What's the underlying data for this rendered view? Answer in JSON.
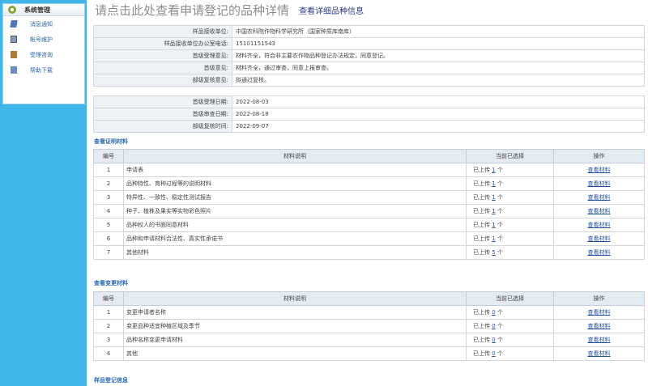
{
  "sidebar": {
    "title": "系统管理",
    "items": [
      {
        "label": "消息通知",
        "icon": "message-icon"
      },
      {
        "label": "帐号维护",
        "icon": "account-icon"
      },
      {
        "label": "受理咨询",
        "icon": "consult-icon"
      },
      {
        "label": "帮助下载",
        "icon": "download-icon"
      }
    ]
  },
  "header": {
    "title": "请点击此处查看申请登记的品种详情",
    "detail_link": "查看详细品种信息"
  },
  "info": [
    {
      "label": "样品接收单位:",
      "value": "中国农科院作物科学研究所（国家种质库南库）"
    },
    {
      "label": "样品接收单位办公室电话:",
      "value": "15101151543"
    },
    {
      "label": "首级受理意见:",
      "value": "材料齐全，符合非主要农作物品种登记办法规定，同意登记。"
    },
    {
      "label": "首级意见:",
      "value": "材料齐全，通过审查，同意上报审查。"
    },
    {
      "label": "部级复核意见:",
      "value": "拟通过复核。"
    }
  ],
  "dates": [
    {
      "label": "首级受理日期:",
      "value": "2022-08-03"
    },
    {
      "label": "首级审查日期:",
      "value": "2022-08-18"
    },
    {
      "label": "部级复核时间:",
      "value": "2022-09-07"
    }
  ],
  "proof": {
    "section_title": "查看证明材料",
    "headers": {
      "no": "编号",
      "desc": "材料说明",
      "sel": "当前已选择",
      "op": "操作"
    },
    "rows": [
      {
        "no": "1",
        "desc": "申请表",
        "sel_pre": "已上传",
        "count": "1",
        "unit": "个",
        "op": "查看材料"
      },
      {
        "no": "2",
        "desc": "品种特性、育种过程等的说明材料",
        "sel_pre": "已上传",
        "count": "1",
        "unit": "个",
        "op": "查看材料"
      },
      {
        "no": "3",
        "desc": "特异性、一致性、稳定性测试报告",
        "sel_pre": "已上传",
        "count": "1",
        "unit": "个",
        "op": "查看材料"
      },
      {
        "no": "4",
        "desc": "种子、植株及果实等实物彩色照片",
        "sel_pre": "已上传",
        "count": "1",
        "unit": "个",
        "op": "查看材料"
      },
      {
        "no": "5",
        "desc": "品种权人的书面同意材料",
        "sel_pre": "已上传",
        "count": "1",
        "unit": "个",
        "op": "查看材料"
      },
      {
        "no": "6",
        "desc": "品种和申请材料合法性、真实性承诺书",
        "sel_pre": "已上传",
        "count": "1",
        "unit": "个",
        "op": "查看材料"
      },
      {
        "no": "7",
        "desc": "其他材料",
        "sel_pre": "已上传",
        "count": "5",
        "unit": "个",
        "op": "查看材料"
      }
    ]
  },
  "change": {
    "section_title": "查看变更材料",
    "headers": {
      "no": "编号",
      "desc": "材料说明",
      "sel": "当前已选择",
      "op": "操作"
    },
    "rows": [
      {
        "no": "1",
        "desc": "变更申请者名称",
        "sel_pre": "已上传",
        "count": "0",
        "unit": "个",
        "op": "查看材料"
      },
      {
        "no": "2",
        "desc": "变更品种适宜种植区域及季节",
        "sel_pre": "已上传",
        "count": "0",
        "unit": "个",
        "op": "查看材料"
      },
      {
        "no": "3",
        "desc": "品种名称变更申请材料",
        "sel_pre": "已上传",
        "count": "0",
        "unit": "个",
        "op": "查看材料"
      },
      {
        "no": "4",
        "desc": "其他",
        "sel_pre": "已上传",
        "count": "0",
        "unit": "个",
        "op": "查看材料"
      }
    ]
  },
  "footer_section": "样品登记信息"
}
